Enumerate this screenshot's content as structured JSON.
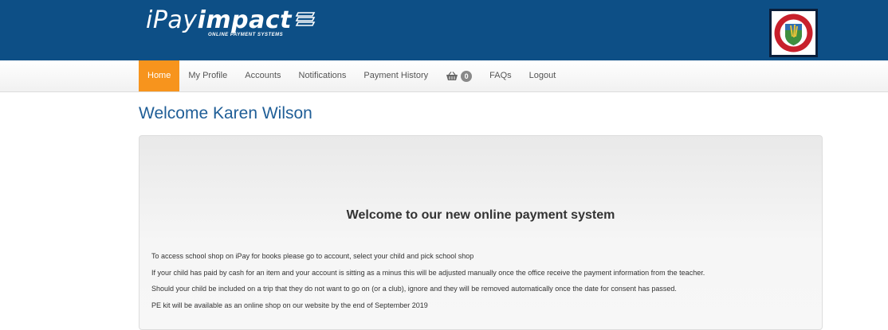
{
  "header": {
    "logo_text_a": "iPay",
    "logo_text_b": "impact",
    "logo_tagline": "ONLINE PAYMENT SYSTEMS",
    "background_color": "#0d4f86"
  },
  "nav": {
    "items": [
      {
        "label": "Home",
        "active": true
      },
      {
        "label": "My Profile"
      },
      {
        "label": "Accounts"
      },
      {
        "label": "Notifications"
      },
      {
        "label": "Payment History"
      },
      {
        "label": "",
        "icon": "basket-icon",
        "badge": "0"
      },
      {
        "label": "FAQs"
      },
      {
        "label": "Logout"
      }
    ],
    "active_color": "#f7941d"
  },
  "page": {
    "welcome": "Welcome Karen Wilson",
    "welcome_color": "#1f5e97"
  },
  "panel": {
    "heading": "Welcome to our new online payment system",
    "lines": [
      "To access school shop on iPay for books please go to account, select your child and pick school shop",
      "If your child has paid by cash for an item and your account is sitting as a minus this will be adjusted manually once the office receive the payment information from the teacher.",
      "Should your child be included on a trip that they do not want to go on (or a club), ignore and they will be removed automatically once the date for consent has passed.",
      "PE kit will be available as an online shop on our website by the end of September 2019"
    ]
  }
}
